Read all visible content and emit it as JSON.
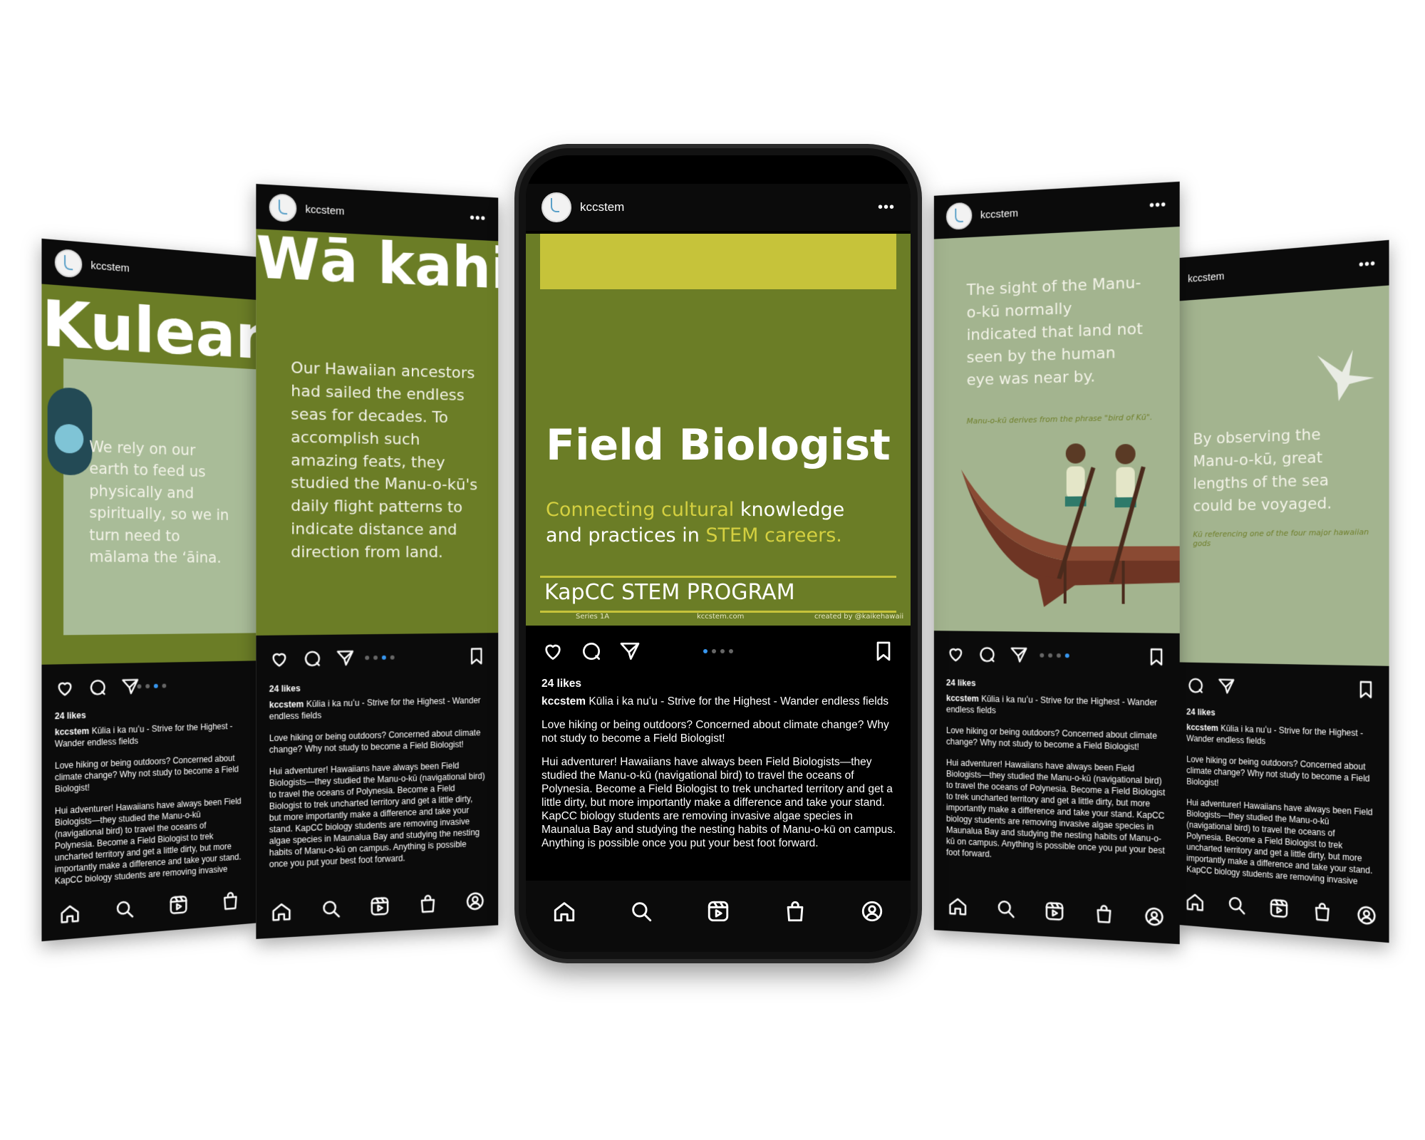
{
  "account": "kccstem",
  "more": "•••",
  "likes": "24 likes",
  "caption_head": "Kūlia i ka nuʻu - Strive for the Highest - Wander endless fields",
  "caption_q": "Love hiking or being outdoors? Concerned about climate change? Why not study to become a Field Biologist!",
  "caption_body": "Hui adventurer! Hawaiians have always been Field Biologists—they studied the Manu-o-kū (navigational bird) to travel the oceans of Polynesia. Become a Field Biologist to trek uncharted territory and get a little dirty, but more importantly make a difference and take your stand. KapCC biology students are removing invasive algae species in Maunalua Bay and studying the nesting habits of Manu-o-kū on campus. Anything is possible once you put your best foot forward.",
  "card1": {
    "title": "Kuleana",
    "text": "We rely on our earth to feed us physically and spiritually, so we in turn need to mālama the ʻāina."
  },
  "card2": {
    "title": "Wā kahiko",
    "text": "Our Hawaiian ancestors had sailed the endless seas for decades. To accomplish such amazing feats, they studied the Manu-o-kū's daily flight patterns to indicate distance and direction from land."
  },
  "center": {
    "title": "Field Biologist",
    "sub_yellow1": "Connecting cultural",
    "sub_white1": " knowledge",
    "sub_white2": "and practices in ",
    "sub_yellow2": "STEM careers.",
    "program": "KapCC STEM PROGRAM",
    "foot_series": "Series 1A",
    "foot_site": "kccstem.com",
    "foot_credit": "created by @kaikehawaii"
  },
  "card4": {
    "text": "The sight of the Manu-o-kū normally indicated that land not seen by the human eye was near by.",
    "note": "Manu-o-kū derives from the phrase \"bird of Kū\"."
  },
  "card5": {
    "text": "By observing the Manu-o-kū, great lengths of the sea could be voyaged.",
    "note": "Kū referencing one of the four major hawaiian gods"
  },
  "colors": {
    "olive": "#6b7d26",
    "sage": "#a3b48f",
    "yellow": "#c6c33a",
    "dot_active": "#3897f0"
  },
  "icons": [
    "heart-icon",
    "comment-icon",
    "share-icon",
    "bookmark-icon",
    "home-icon",
    "search-icon",
    "reels-icon",
    "shop-icon",
    "profile-icon"
  ]
}
